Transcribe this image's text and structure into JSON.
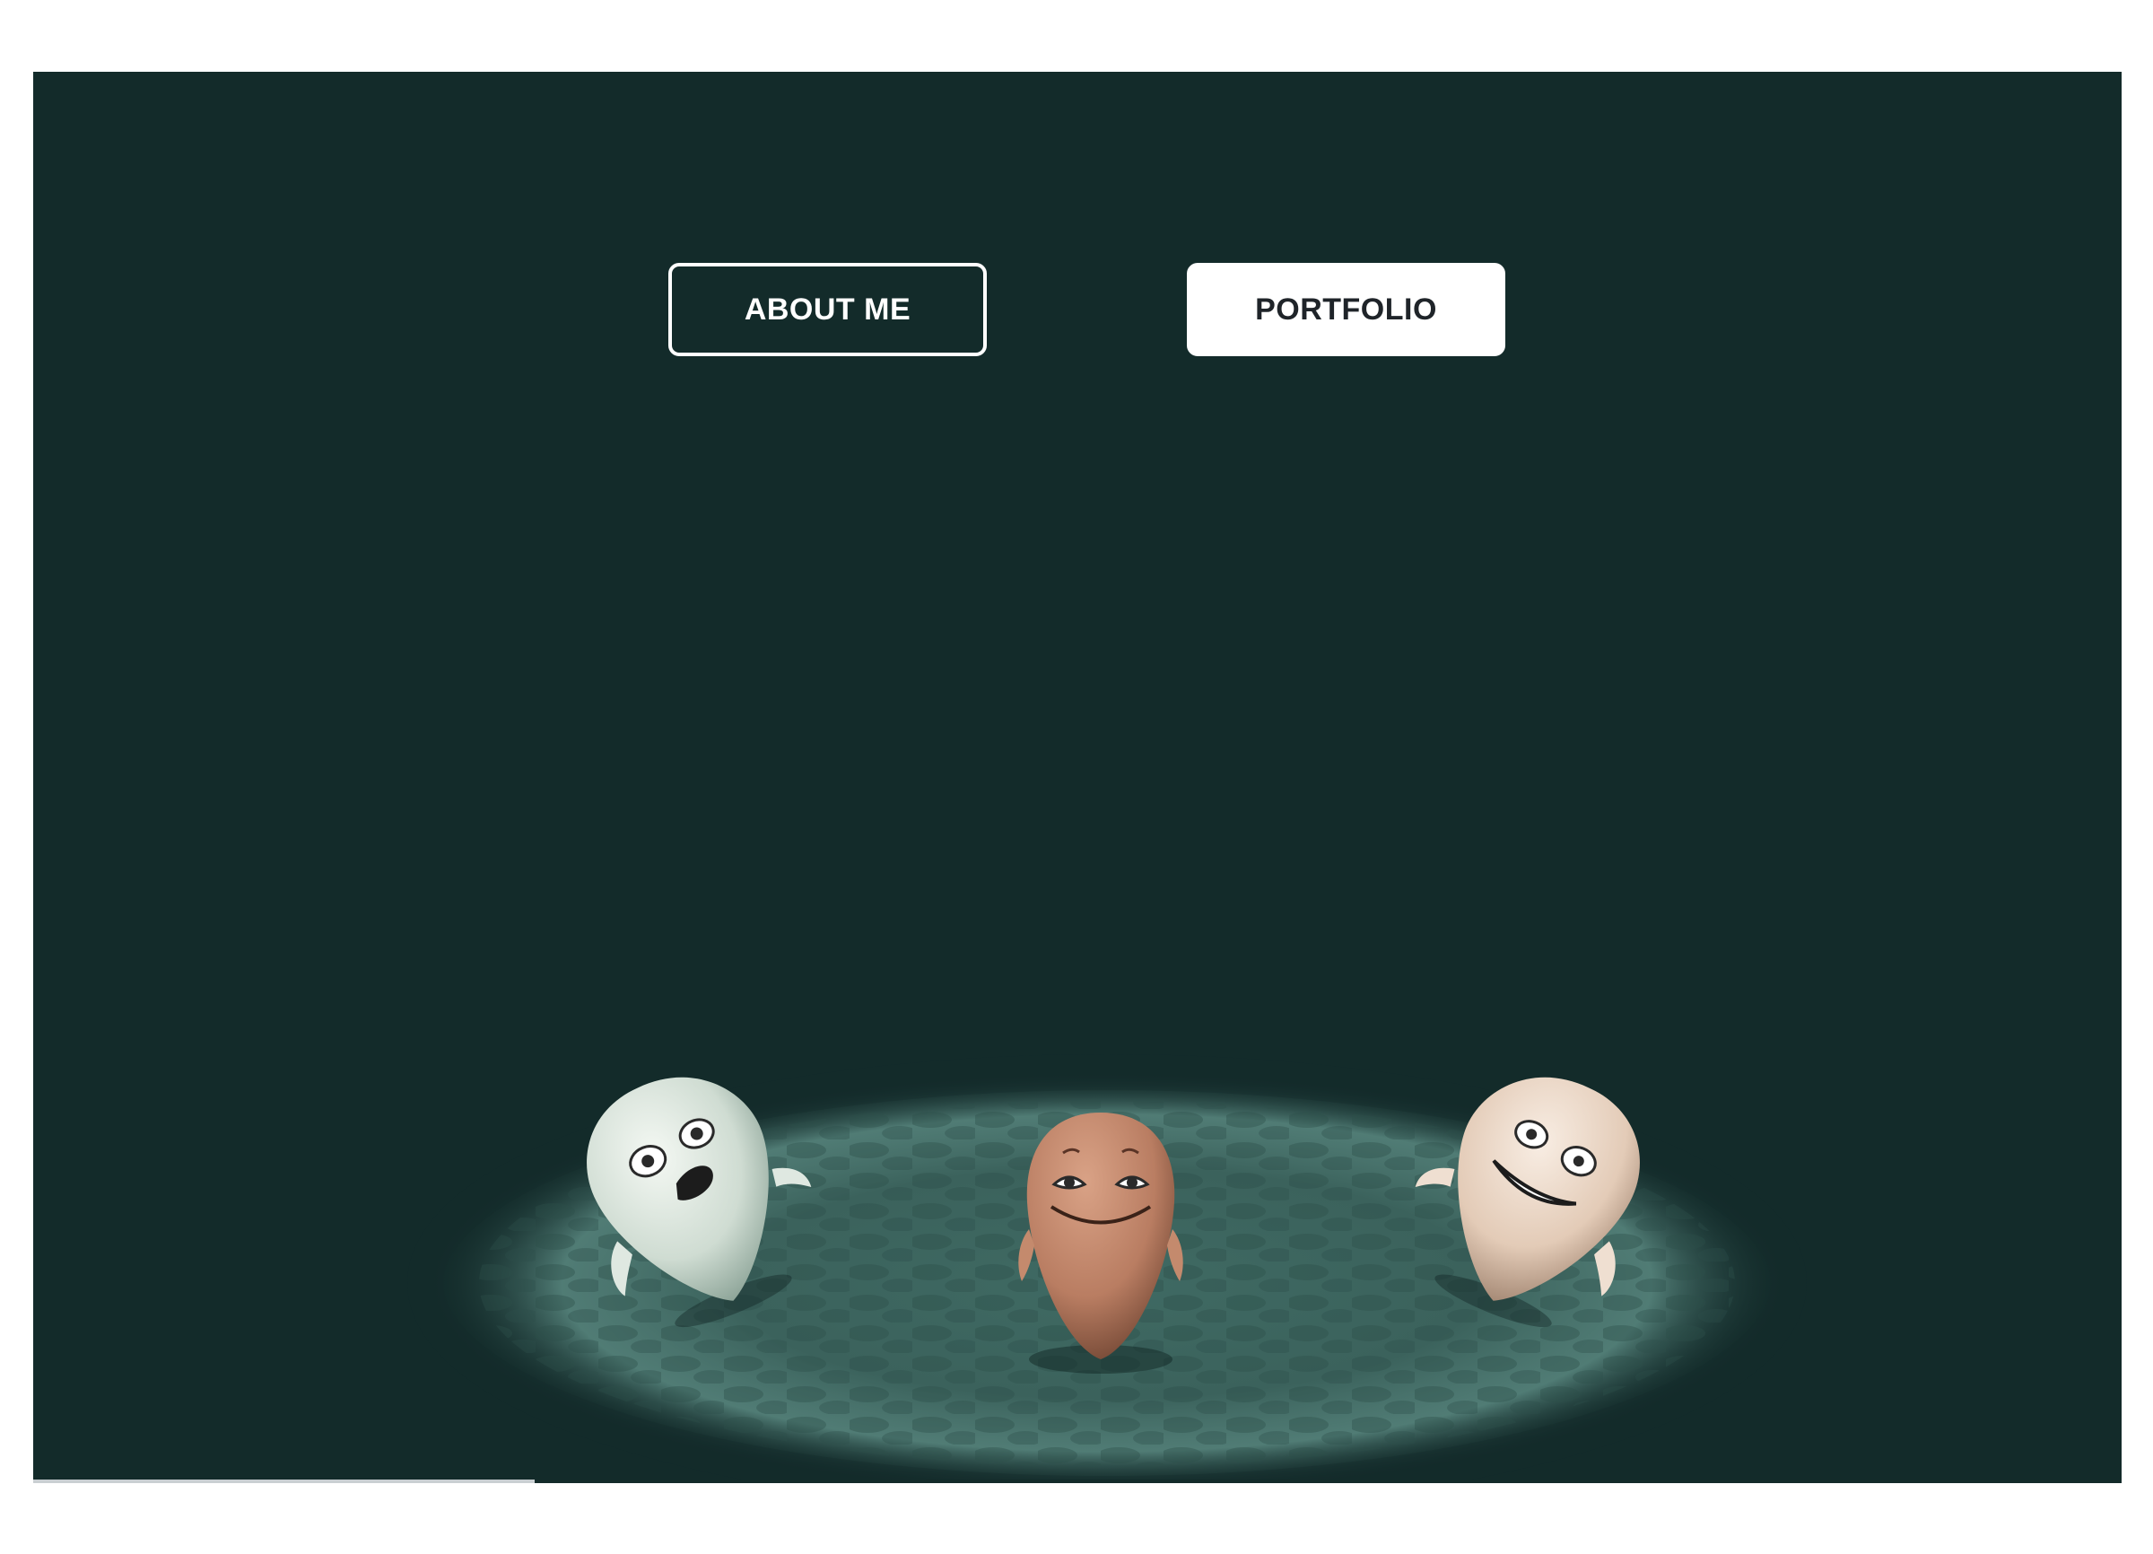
{
  "nav": {
    "about_label": "ABOUT ME",
    "portfolio_label": "PORTFOLIO"
  },
  "colors": {
    "background": "#132b2a",
    "button_text_dark": "#1f2429",
    "button_border": "#ffffff",
    "spotlight": "#5c8a80",
    "character_left": "#d9e3da",
    "character_center": "#c58a6e",
    "character_right": "#ecd8c6"
  },
  "scene": {
    "characters": [
      {
        "name": "white-character",
        "expression": "surprised"
      },
      {
        "name": "tan-character",
        "expression": "smiling"
      },
      {
        "name": "cream-character",
        "expression": "grinning"
      }
    ]
  },
  "loading_progress": 0.24
}
